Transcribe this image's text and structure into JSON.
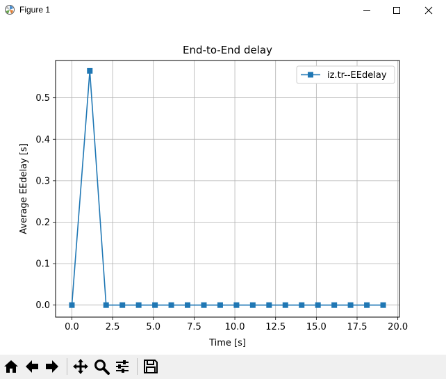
{
  "window": {
    "title": "Figure 1",
    "icon": "matplotlib-icon",
    "controls": [
      "minimize-icon",
      "maximize-icon",
      "close-icon"
    ]
  },
  "toolbar": {
    "buttons": [
      "home-icon",
      "back-arrow-icon",
      "forward-arrow-icon",
      "pan-icon",
      "zoom-icon",
      "configure-subplots-icon",
      "save-icon"
    ]
  },
  "chart_data": {
    "type": "line",
    "title": "End-to-End delay",
    "xlabel": "Time [s]",
    "ylabel": "Average EEdelay [s]",
    "xlim": [
      -1.0,
      20.1
    ],
    "ylim": [
      -0.029,
      0.59
    ],
    "xticks": [
      0.0,
      2.5,
      5.0,
      7.5,
      10.0,
      12.5,
      15.0,
      17.5,
      20.0
    ],
    "xtick_labels": [
      "0.0",
      "2.5",
      "5.0",
      "7.5",
      "10.0",
      "12.5",
      "15.0",
      "17.5",
      "20.0"
    ],
    "yticks": [
      0.0,
      0.1,
      0.2,
      0.3,
      0.4,
      0.5
    ],
    "ytick_labels": [
      "0.0",
      "0.1",
      "0.2",
      "0.3",
      "0.4",
      "0.5"
    ],
    "grid": true,
    "legend_position": "top-right",
    "series": [
      {
        "name": "iz.tr--EEdelay",
        "color": "#1f77b4",
        "marker": "square",
        "x": [
          0.0,
          1.1,
          2.1,
          3.1,
          4.1,
          5.1,
          6.1,
          7.1,
          8.1,
          9.1,
          10.1,
          11.1,
          12.1,
          13.1,
          14.1,
          15.1,
          16.1,
          17.1,
          18.1,
          19.1
        ],
        "y": [
          0.0,
          0.565,
          0.0,
          0.0,
          0.0,
          0.0,
          0.0,
          0.0,
          0.0,
          0.0,
          0.0,
          0.0,
          0.0,
          0.0,
          0.0,
          0.0,
          0.0,
          0.0,
          0.0,
          0.0
        ]
      }
    ]
  }
}
